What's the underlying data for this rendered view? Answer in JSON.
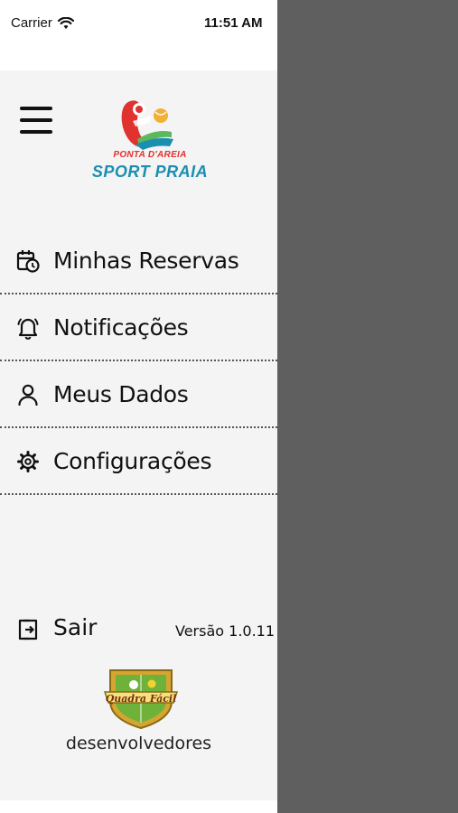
{
  "status_bar": {
    "carrier": "Carrier",
    "time": "11:51 AM"
  },
  "logo": {
    "subtitle": "PONTA D'AREIA",
    "title": "SPORT PRAIA"
  },
  "menu": {
    "items": [
      {
        "label": "Minhas Reservas",
        "icon": "calendar-clock-icon"
      },
      {
        "label": "Notificações",
        "icon": "bell-icon"
      },
      {
        "label": "Meus Dados",
        "icon": "person-icon"
      },
      {
        "label": "Configurações",
        "icon": "gear-icon"
      }
    ]
  },
  "footer": {
    "logout_label": "Sair",
    "version": "Versão 1.0.11",
    "badge_text": "Quadra Fácil",
    "developers": "desenvolvedores"
  },
  "colors": {
    "drawer_bg": "#f4f4f4",
    "overlay": "#5f5f5f",
    "brand_red": "#e0322f",
    "brand_blue": "#1a8fb0",
    "brand_green": "#5cb85c"
  }
}
